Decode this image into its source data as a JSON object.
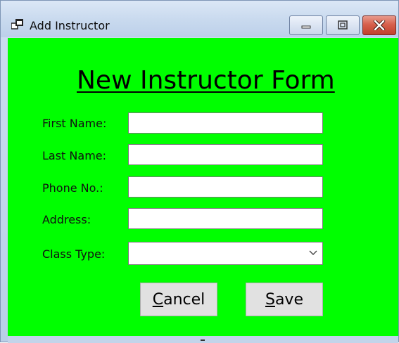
{
  "window": {
    "title": "Add Instructor",
    "controls": [
      "minimize-icon",
      "maximize-icon",
      "close-icon"
    ]
  },
  "form": {
    "heading": "New Instructor Form",
    "background_color": "#00ff00",
    "fields": [
      {
        "label": "First Name:",
        "value": "",
        "type": "text"
      },
      {
        "label": "Last Name:",
        "value": "",
        "type": "text"
      },
      {
        "label": "Phone No.:",
        "value": "",
        "type": "text"
      },
      {
        "label": "Address:",
        "value": "",
        "type": "text"
      },
      {
        "label": "Class Type:",
        "value": "",
        "type": "dropdown"
      }
    ],
    "buttons": {
      "cancel": {
        "mnemonic": "C",
        "rest": "ancel"
      },
      "save": {
        "mnemonic": "S",
        "rest": "ave"
      }
    }
  },
  "colors": {
    "form_background": "#00ff00",
    "close_button": "#c94f3c",
    "titlebar": "#c8d9ee"
  }
}
